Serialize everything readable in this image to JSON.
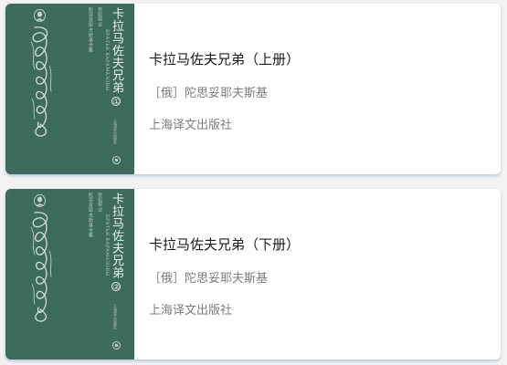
{
  "books": [
    {
      "title": "卡拉马佐夫兄弟（上册）",
      "author": "［俄］陀思妥耶夫斯基",
      "publisher": "上海译文出版社",
      "cover": {
        "title_text": "卡拉马佐夫兄弟",
        "volume_mark": "①",
        "series_text": "陀思妥耶夫斯基全集",
        "latin_text": "БРАТЬЯ КАРАМАЗОВЫ",
        "translator_text": "荣如德 译",
        "publisher_text": "上海译文出版社",
        "color": "#3c6a5d"
      }
    },
    {
      "title": "卡拉马佐夫兄弟（下册）",
      "author": "［俄］陀思妥耶夫斯基",
      "publisher": "上海译文出版社",
      "cover": {
        "title_text": "卡拉马佐夫兄弟",
        "volume_mark": "②",
        "series_text": "陀思妥耶夫斯基全集",
        "latin_text": "БРАТЬЯ КАРАМАЗОВЫ",
        "translator_text": "荣如德 译",
        "publisher_text": "上海译文出版社",
        "color": "#3c6a5d"
      }
    }
  ],
  "colors": {
    "page_background": "#f2f2f2",
    "card_background": "#ffffff",
    "title_text": "#1c1c1c",
    "secondary_text": "#7c7c7c",
    "card_shadow": "#7896be"
  }
}
